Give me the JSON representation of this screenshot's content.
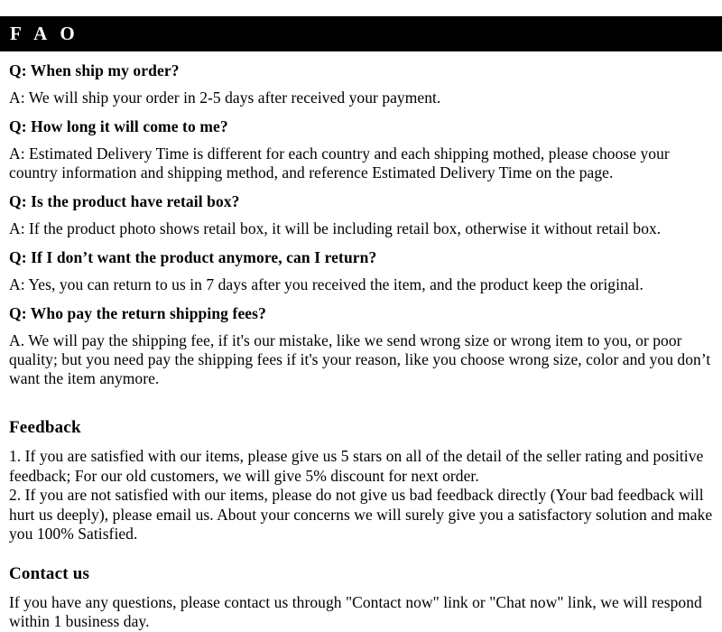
{
  "header": {
    "title": "F A O",
    "background_color": "#000000",
    "text_color": "#ffffff"
  },
  "faq": {
    "items": [
      {
        "question": "Q: When ship my order?",
        "answer": "A: We will ship your order in 2-5 days after received your payment."
      },
      {
        "question": "Q: How long it will come to me?",
        "answer": "A: Estimated Delivery Time is different for each country and each shipping mothed, please choose your country information and shipping method, and reference Estimated Delivery Time on the page."
      },
      {
        "question": "Q: Is the product have retail box?",
        "answer": "A: If  the product photo shows retail box, it will be including retail box, otherwise it without retail box."
      },
      {
        "question": "Q: If  I don’t want the product anymore, can I return?",
        "answer": "A: Yes, you can return to us in 7 days after you received the item, and the product keep the original."
      },
      {
        "question": "Q: Who pay the return shipping fees?",
        "answer": "A.  We will pay the shipping fee, if  it's our mistake, like we send wrong size or wrong item to you, or poor quality; but you need pay the shipping fees if  it's your reason, like you choose wrong size, color and you don’t want the item anymore."
      }
    ]
  },
  "feedback": {
    "title": "Feedback",
    "items": [
      "1.  If you are satisfied with our items, please give us 5 stars on all of the detail of the seller rating and positive feedback; For our old customers, we will give 5% discount for next order.",
      "2.  If you are not satisfied with our items, please do not give us bad feedback directly (Your bad feedback will hurt us deeply), please email us. About your concerns we will surely give you a satisfactory solution and make you 100% Satisfied."
    ]
  },
  "contact": {
    "title": "Contact us",
    "body": "If you have any questions, please contact us through \"Contact now\" link or \"Chat now\" link, we will respond within 1 business day."
  }
}
